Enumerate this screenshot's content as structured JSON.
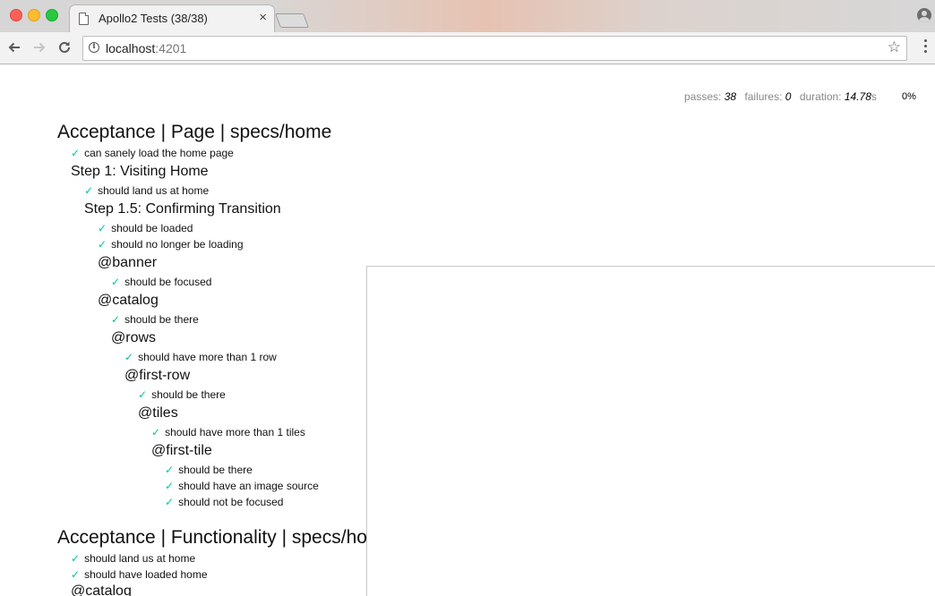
{
  "browser": {
    "tab_title": "Apollo2 Tests (38/38)",
    "tab_close": "×",
    "url_host": "localhost",
    "url_port": ":4201"
  },
  "stats": {
    "passes_label": "passes:",
    "passes_value": "38",
    "failures_label": "failures:",
    "failures_value": "0",
    "duration_label": "duration:",
    "duration_value": "14.78",
    "duration_unit": "s",
    "progress": "0%"
  },
  "check_glyph": "✓",
  "report": {
    "suites": [
      {
        "title": "Acceptance | Page | specs/home"
      },
      {
        "title": "Step 1: Visiting Home"
      },
      {
        "title": "Step 1.5: Confirming Transition"
      },
      {
        "title": "@banner"
      },
      {
        "title": "@catalog"
      },
      {
        "title": "@rows"
      },
      {
        "title": "@first-row"
      },
      {
        "title": "@tiles"
      },
      {
        "title": "@first-tile"
      },
      {
        "title": "Acceptance | Functionality | specs/home"
      },
      {
        "title": "@catalog"
      }
    ],
    "tests": [
      {
        "title": "can sanely load the home page"
      },
      {
        "title": "should land us at home"
      },
      {
        "title": "should be loaded"
      },
      {
        "title": "should no longer be loading"
      },
      {
        "title": "should be focused"
      },
      {
        "title": "should be there"
      },
      {
        "title": "should have more than 1 row"
      },
      {
        "title": "should be there"
      },
      {
        "title": "should have more than 1 tiles"
      },
      {
        "title": "should be there"
      },
      {
        "title": "should have an image source"
      },
      {
        "title": "should not be focused"
      },
      {
        "title": "should land us at home"
      },
      {
        "title": "should have loaded home"
      }
    ]
  }
}
